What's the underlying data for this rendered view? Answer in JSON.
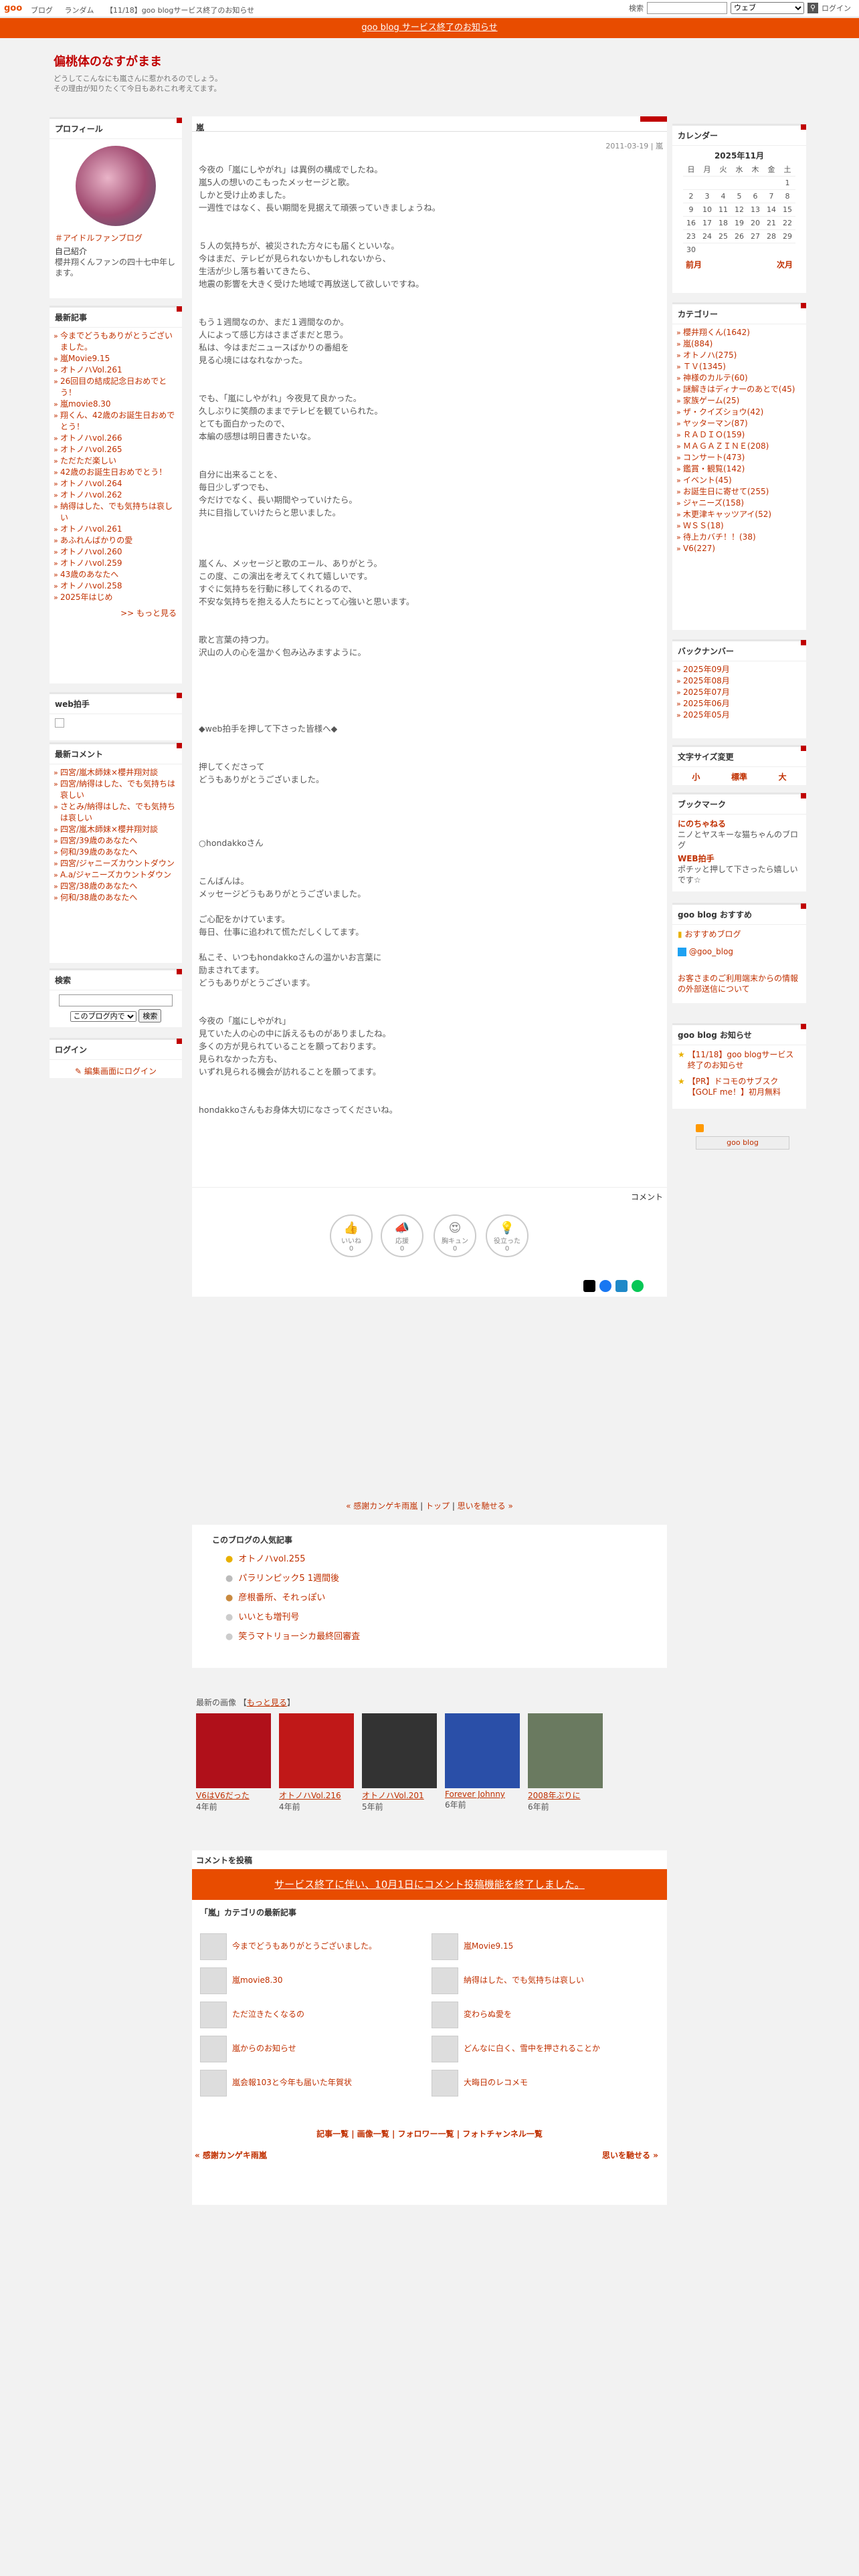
{
  "topbar": {
    "logo": "goo",
    "links": [
      "ブログ",
      "ランダム",
      "【11/18】goo blogサービス終了のお知らせ"
    ],
    "search_label": "検索",
    "search_scope": "ウェブ",
    "login": "ログイン"
  },
  "notice": "goo blog サービス終了のお知らせ",
  "header": {
    "title": "偏桃体のなすがまま",
    "desc1": "どうしてこんなにも嵐さんに惹かれるのでしょう。",
    "desc2": "その理由が知りたくて今日もあれこれ考えてます。"
  },
  "profile": {
    "title": "プロフィール",
    "name": "＃アイドルファンブログ",
    "intro_title": "自己紹介",
    "intro": "櫻井翔くんファンの四十七中年します。"
  },
  "recent": {
    "title": "最新記事",
    "items": [
      "今までどうもありがとうございました。",
      "嵐Movie9.15",
      "オトノハVol.261",
      "26回目の結成記念日おめでとう！",
      "嵐movie8.30",
      "翔くん、42歳のお誕生日おめでとう！",
      "オトノハvol.266",
      "オトノハvol.265",
      "ただただ楽しい",
      "42歳のお誕生日おめでとう！",
      "オトノハvol.264",
      "オトノハvol.262",
      "納得はした、でも気持ちは哀しい",
      "オトノハvol.261",
      "あふれんばかりの愛",
      "オトノハvol.260",
      "オトノハvol.259",
      "43歳のあなたへ",
      "オトノハvol.258",
      "2025年はじめ"
    ],
    "more": ">> もっと見る"
  },
  "webclap": {
    "title": "web拍手"
  },
  "comments": {
    "title": "最新コメント",
    "items": [
      "四宮/嵐木師妹×櫻井翔対談",
      "四宮/納得はした、でも気持ちは哀しい",
      "さとみ/納得はした、でも気持ちは哀しい",
      "四宮/嵐木師妹×櫻井翔対談",
      "四宮/39歳のあなたへ",
      "何和/39歳のあなたへ",
      "四宮/ジャニーズカウントダウン",
      "A.a/ジャニーズカウントダウン",
      "四宮/38歳のあなたへ",
      "何和/38歳のあなたへ"
    ]
  },
  "search": {
    "title": "検索",
    "scope": "このブログ内で",
    "button": "検索"
  },
  "login": {
    "title": "ログイン",
    "link": "編集画面にログイン"
  },
  "entry": {
    "category": "嵐",
    "date": "2011-03-19 | 嵐",
    "body": "今夜の「嵐にしやがれ」は異例の構成でしたね。\n嵐5人の想いのこもったメッセージと歌。\nしかと受け止めました。\n一週性ではなく、長い期間を見据えて頑張っていきましょうね。\n\n\n５人の気持ちが、被災された方々にも届くといいな。\n今はまだ、テレビが見られないかもしれないから、\n生活が少し落ち着いてきたら、\n地震の影響を大きく受けた地域で再放送して欲しいですね。\n\n\nもう１週間なのか、まだ１週間なのか。\n人によって感じ方はさまざまだと思う。\n私は、今はまだニュースばかりの番組を\n見る心境にはなれなかった。\n\n\nでも、「嵐にしやがれ」今夜見て良かった。\n久しぶりに笑顔のままでテレビを観ていられた。\nとても面白かったので、\n本編の感想は明日書きたいな。\n\n\n自分に出来ることを、\n毎日少しずつでも、\n今だけでなく、長い期間やっていけたら。\n共に目指していけたらと思いました。\n\n\n\n嵐くん、メッセージと歌のエール、ありがとう。\nこの度、この演出を考えてくれて嬉しいです。\nすぐに気持ちを行動に移してくれるので、\n不安な気持ちを抱える人たちにとって心強いと思います。\n\n\n歌と言葉の持つ力。\n沢山の人の心を温かく包み込みますように。\n\n\n\n\n\n◆web拍手を押して下さった皆様へ◆\n\n\n押してくださって\nどうもありがとうございました。\n\n\n\n\n○hondakkoさん\n\n\nこんばんは。\nメッセージどうもありがとうございました。\n\nご心配をかけています。\n毎日、仕事に追われて慌ただしくしてます。\n\n私こそ、いつもhondakkoさんの温かいお言葉に\n励まされてます。\nどうもありがとうございます。\n\n\n今夜の「嵐にしやがれ」\n見ていた人の心の中に訴えるものがありましたね。\n多くの方が見られていることを願っております。\n見られなかった方も、\nいずれ見られる機会が訪れることを願ってます。\n\n\nhondakkoさんもお身体大切になさってくださいね。",
    "comment_label": "コメント"
  },
  "reactions": [
    {
      "label": "いいね",
      "count": "0"
    },
    {
      "label": "応援",
      "count": "0"
    },
    {
      "label": "胸キュン",
      "count": "0"
    },
    {
      "label": "役立った",
      "count": "0"
    }
  ],
  "nav": {
    "prev": "« 感謝カンゲキ雨嵐",
    "sep1": " | ",
    "top": "トップ",
    "sep2": " | ",
    "next": "思いを馳せる »"
  },
  "popular": {
    "title": "このブログの人気記事",
    "items": [
      "オトノハvol.255",
      "パラリンピック5 1週間後",
      "彦根番所、それっぽい",
      "いいとも増刊号",
      "笑うマトリョーシカ最終回審査"
    ]
  },
  "images": {
    "title": "最新の画像",
    "more": "もっと見る",
    "items": [
      {
        "t": "V6はV6だった",
        "d": "4年前"
      },
      {
        "t": "オトノハVol.216",
        "d": "4年前"
      },
      {
        "t": "オトノハVol.201",
        "d": "5年前"
      },
      {
        "t": "Forever Johnny",
        "d": "6年前"
      },
      {
        "t": "2008年ぶりに",
        "d": "6年前"
      }
    ]
  },
  "comment_post": {
    "title": "コメントを投稿",
    "banner": "サービス終了に伴い、10月1日にコメント投稿機能を終了しました。",
    "cat_title": "「嵐」カテゴリの最新記事",
    "left": [
      "今までどうもありがとうございました。",
      "嵐movie8.30",
      "ただ泣きたくなるの",
      "嵐からのお知らせ",
      "嵐会報103と今年も届いた年賀状"
    ],
    "right": [
      "嵐Movie9.15",
      "納得はした、でも気持ちは哀しい",
      "変わらぬ愛を",
      "どんなに白く、雪中を押されることか",
      "大晦日のレコメモ"
    ]
  },
  "footer_links": "記事一覧 | 画像一覧 | フォロワー一覧 | フォトチャンネル一覧",
  "bottom_nav": {
    "prev": "« 感謝カンゲキ雨嵐",
    "next": "思いを馳せる »"
  },
  "calendar": {
    "title": "カレンダー",
    "month": "2025年11月",
    "days": [
      "日",
      "月",
      "火",
      "水",
      "木",
      "金",
      "土"
    ],
    "weeks": [
      [
        "",
        "",
        "",
        "",
        "",
        "",
        "1"
      ],
      [
        "2",
        "3",
        "4",
        "5",
        "6",
        "7",
        "8"
      ],
      [
        "9",
        "10",
        "11",
        "12",
        "13",
        "14",
        "15"
      ],
      [
        "16",
        "17",
        "18",
        "19",
        "20",
        "21",
        "22"
      ],
      [
        "23",
        "24",
        "25",
        "26",
        "27",
        "28",
        "29"
      ],
      [
        "30",
        "",
        "",
        "",
        "",
        "",
        ""
      ]
    ],
    "prev": "前月",
    "next": "次月"
  },
  "categories": {
    "title": "カテゴリー",
    "items": [
      "櫻井翔くん(1642)",
      "嵐(884)",
      "オトノハ(275)",
      "ＴＶ(1345)",
      "神様のカルテ(60)",
      "謎解きはディナーのあとで(45)",
      "家族ゲーム(25)",
      "ザ・クイズショウ(42)",
      "ヤッターマン(87)",
      "ＲＡＤＩＯ(159)",
      "ＭＡＧＡＺＩＮＥ(208)",
      "コンサート(473)",
      "鑑賞・観覧(142)",
      "イベント(45)",
      "お誕生日に寄せて(255)",
      "ジャニーズ(158)",
      "木更津キャッツアイ(52)",
      "ＷＳＳ(18)",
      "待上カバチ！！(38)",
      "V6(227)"
    ]
  },
  "backnumber": {
    "title": "バックナンバー",
    "items": [
      "2025年09月",
      "2025年08月",
      "2025年07月",
      "2025年06月",
      "2025年05月"
    ]
  },
  "fontsize": {
    "title": "文字サイズ変更",
    "s": "小",
    "m": "標準",
    "l": "大"
  },
  "bookmark": {
    "title": "ブックマーク",
    "a": "にのちゃねる",
    "a_desc": "ニノとヤスキーな猫ちゃんのブログ",
    "b": "WEB拍手",
    "b_desc": "ポチッと押して下さったら嬉しいです☆"
  },
  "recommend": {
    "title": "goo blog おすすめ",
    "a": "おすすめブログ",
    "b": "@goo_blog",
    "c": "お客さまのご利用端末からの情報の外部送信について"
  },
  "gnotice": {
    "title": "goo blog お知らせ",
    "a": "【11/18】goo blogサービス終了のお知らせ",
    "b": "【PR】ドコモのサブスク【GOLF me！】初月無料"
  },
  "gooblog_badge": "goo blog",
  "colors": {
    "accent": "#c00000",
    "notice": "#e84c00",
    "link": "#c03000"
  }
}
